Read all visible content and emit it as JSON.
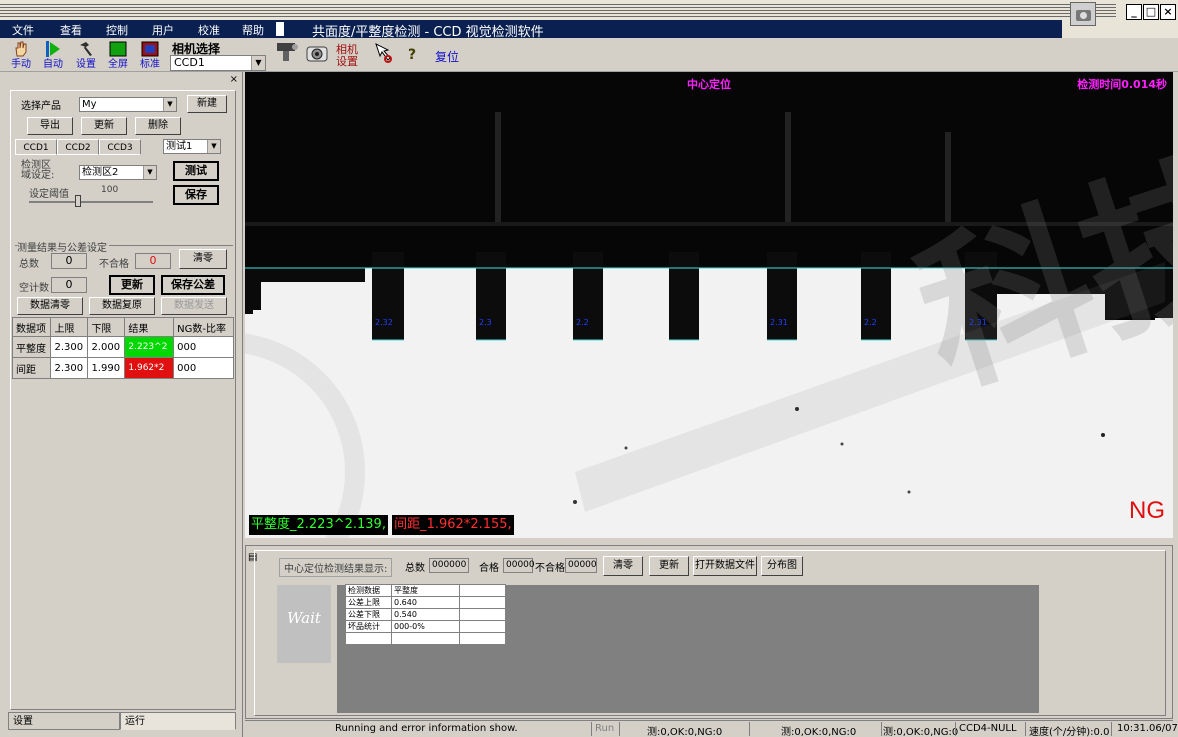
{
  "menu": [
    "文件",
    "查看",
    "控制",
    "用户",
    "校准",
    "帮助"
  ],
  "window_title": "共面度/平整度检测 - CCD 视觉检测软件",
  "window_buttons": {
    "minimize": "_",
    "restore": "□",
    "close": "×"
  },
  "toolbar": {
    "manual": "手动",
    "auto": "自动",
    "settings": "设置",
    "fullscreen": "全屏",
    "standard": "标准",
    "camera_select_label": "相机选择",
    "camera_selected": "CCD1",
    "camera_settings": "相机\n设置",
    "help": "?",
    "reset": "复位"
  },
  "left_panel": {
    "close": "×",
    "product_label": "选择产品",
    "product_value": "My",
    "new_btn": "新建",
    "export_btn": "导出",
    "update_btn": "更新",
    "delete_btn": "删除",
    "tabs": [
      "CCD1",
      "CCD2",
      "CCD3"
    ],
    "test_select": "测试1",
    "region_label": "检测区\n域设定:",
    "region_value": "检测区2",
    "test_btn": "测试",
    "save_btn": "保存",
    "threshold_label": "设定阈值",
    "threshold_value": "100",
    "group_title": "测量结果与公差设定",
    "total_label": "总数",
    "total_value": "0",
    "fail_label": "不合格",
    "fail_value": "0",
    "clear_btn": "清零",
    "empty_label": "空计数",
    "empty_value": "0",
    "refresh_btn": "更新",
    "save_tol_btn": "保存公差",
    "data_clear_btn": "数据清零",
    "data_restore_btn": "数据复原",
    "data_send_btn": "数据发送",
    "table_headers": [
      "数据项",
      "上限",
      "下限",
      "结果",
      "NG数-比率"
    ],
    "table_rows": [
      {
        "name": "平整度",
        "upper": "2.300",
        "lower": "2.000",
        "result": "2.223^2",
        "ng": "000",
        "status": "ok"
      },
      {
        "name": "间距",
        "upper": "2.300",
        "lower": "1.990",
        "result": "1.962*2",
        "ng": "000",
        "status": "ng"
      }
    ],
    "bottom_tabs": [
      "设置",
      "运行"
    ]
  },
  "view": {
    "title": "中心定位",
    "detect_time": "检测时间0.014秒",
    "verdict": "NG",
    "flatness_readout": "平整度_2.223^2.139,",
    "gap_readout": "间距_1.962*2.155,",
    "pin_labels": [
      "2.32",
      "2.3",
      "2.2",
      "",
      "2.31",
      "2.2",
      "2.31"
    ],
    "watermark": "科技"
  },
  "results": {
    "group_label": "中心定位检测结果显示:",
    "total_label": "总数",
    "total_value": "000000",
    "pass_label": "合格",
    "pass_value": "00000",
    "fail_label": "不合格",
    "fail_value": "00000",
    "clear_btn": "清零",
    "update_btn": "更新",
    "open_file_btn": "打开数据文件",
    "distribution_btn": "分布图",
    "wait_label": "Wait",
    "table": [
      [
        "检测数据",
        "平整度",
        ""
      ],
      [
        "公差上限",
        "0.640",
        ""
      ],
      [
        "公差下限",
        "0.540",
        ""
      ],
      [
        "坏品统计",
        "000-0%",
        ""
      ],
      [
        "",
        "",
        ""
      ]
    ]
  },
  "statusbar": {
    "message": "Running and error information show.",
    "run": "Run",
    "stat1": "测:0,OK:0,NG:0",
    "stat2": "测:0,OK:0,NG:0",
    "stat3": "测:0,OK:0,NG:0",
    "camera": "CCD4-NULL",
    "speed": "速度(个/分钟):0.0",
    "time": "10:31.06/07"
  },
  "colors": {
    "ok": "#00d800",
    "ng": "#e01010",
    "magenta": "#ff20ff",
    "menu_bg": "#0a2050"
  }
}
